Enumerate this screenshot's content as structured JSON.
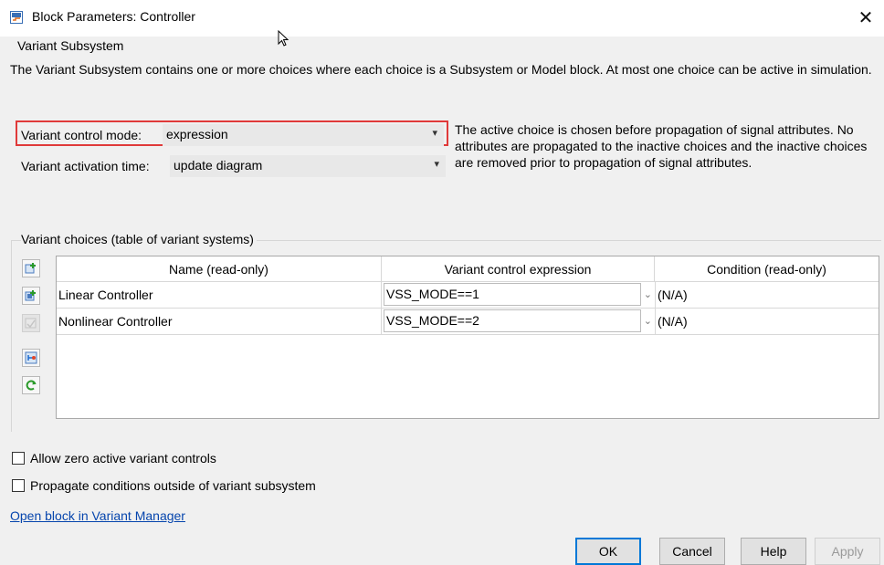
{
  "window": {
    "title": "Block Parameters: Controller",
    "close_glyph": "✕"
  },
  "group": {
    "title": "Variant Subsystem",
    "description": "The Variant Subsystem contains one or more choices where each choice is a Subsystem or Model block. At most one choice can be active in simulation."
  },
  "control_mode": {
    "label": "Variant control mode:",
    "value": "expression"
  },
  "activation_time": {
    "label": "Variant activation time:",
    "value": "update diagram"
  },
  "side_note": "The active choice is chosen before propagation of signal attributes. No attributes are propagated to the inactive choices and the inactive choices are removed prior to propagation of signal attributes.",
  "choices": {
    "label": "Variant choices (table of variant systems)",
    "columns": [
      "Name (read-only)",
      "Variant control expression",
      "Condition (read-only)"
    ],
    "rows": [
      {
        "name": "Linear Controller",
        "expression": "VSS_MODE==1",
        "condition": "(N/A)"
      },
      {
        "name": "Nonlinear Controller",
        "expression": "VSS_MODE==2",
        "condition": "(N/A)"
      }
    ]
  },
  "options": {
    "allow_zero": {
      "label": "Allow zero active variant controls",
      "checked": false
    },
    "propagate": {
      "label": "Propagate conditions outside of variant subsystem",
      "checked": false
    }
  },
  "link": "Open block in Variant Manager",
  "buttons": {
    "ok": "OK",
    "cancel": "Cancel",
    "help": "Help",
    "apply": "Apply"
  },
  "icons": {
    "app": "simulink-block-icon",
    "toolbar": [
      "add-subsystem-choice-icon",
      "add-model-choice-icon",
      "edit-choice-icon",
      "create-variant-icon",
      "refresh-icon"
    ]
  },
  "colors": {
    "highlight": "#e03a3a",
    "link": "#0645ad",
    "focus": "#0078d7"
  }
}
